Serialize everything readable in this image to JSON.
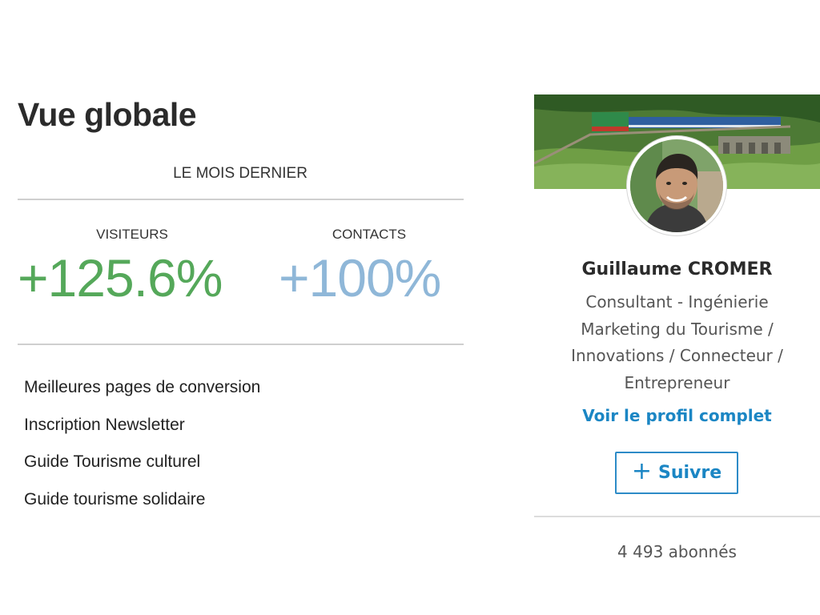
{
  "overview": {
    "title": "Vue globale",
    "period": "LE MOIS DERNIER",
    "stats": [
      {
        "label": "VISITEURS",
        "value": "+125.6%",
        "color": "#55a85a"
      },
      {
        "label": "CONTACTS",
        "value": "+100%",
        "color": "#8fb7d8"
      }
    ],
    "pages": [
      "Meilleures pages de conversion",
      "Inscription Newsletter",
      "Guide Tourisme culturel",
      "Guide tourisme solidaire"
    ]
  },
  "profile": {
    "name": "Guillaume CROMER",
    "headline_lines": [
      "Consultant - Ingénierie",
      "Marketing du Tourisme /",
      "Innovations / Connecteur /",
      "Entrepreneur"
    ],
    "profile_link": "Voir le profil complet",
    "follow": {
      "icon": "plus-icon",
      "label": "Suivre"
    },
    "followers": "4 493 abonnés",
    "accent_color": "#1b86c4"
  }
}
